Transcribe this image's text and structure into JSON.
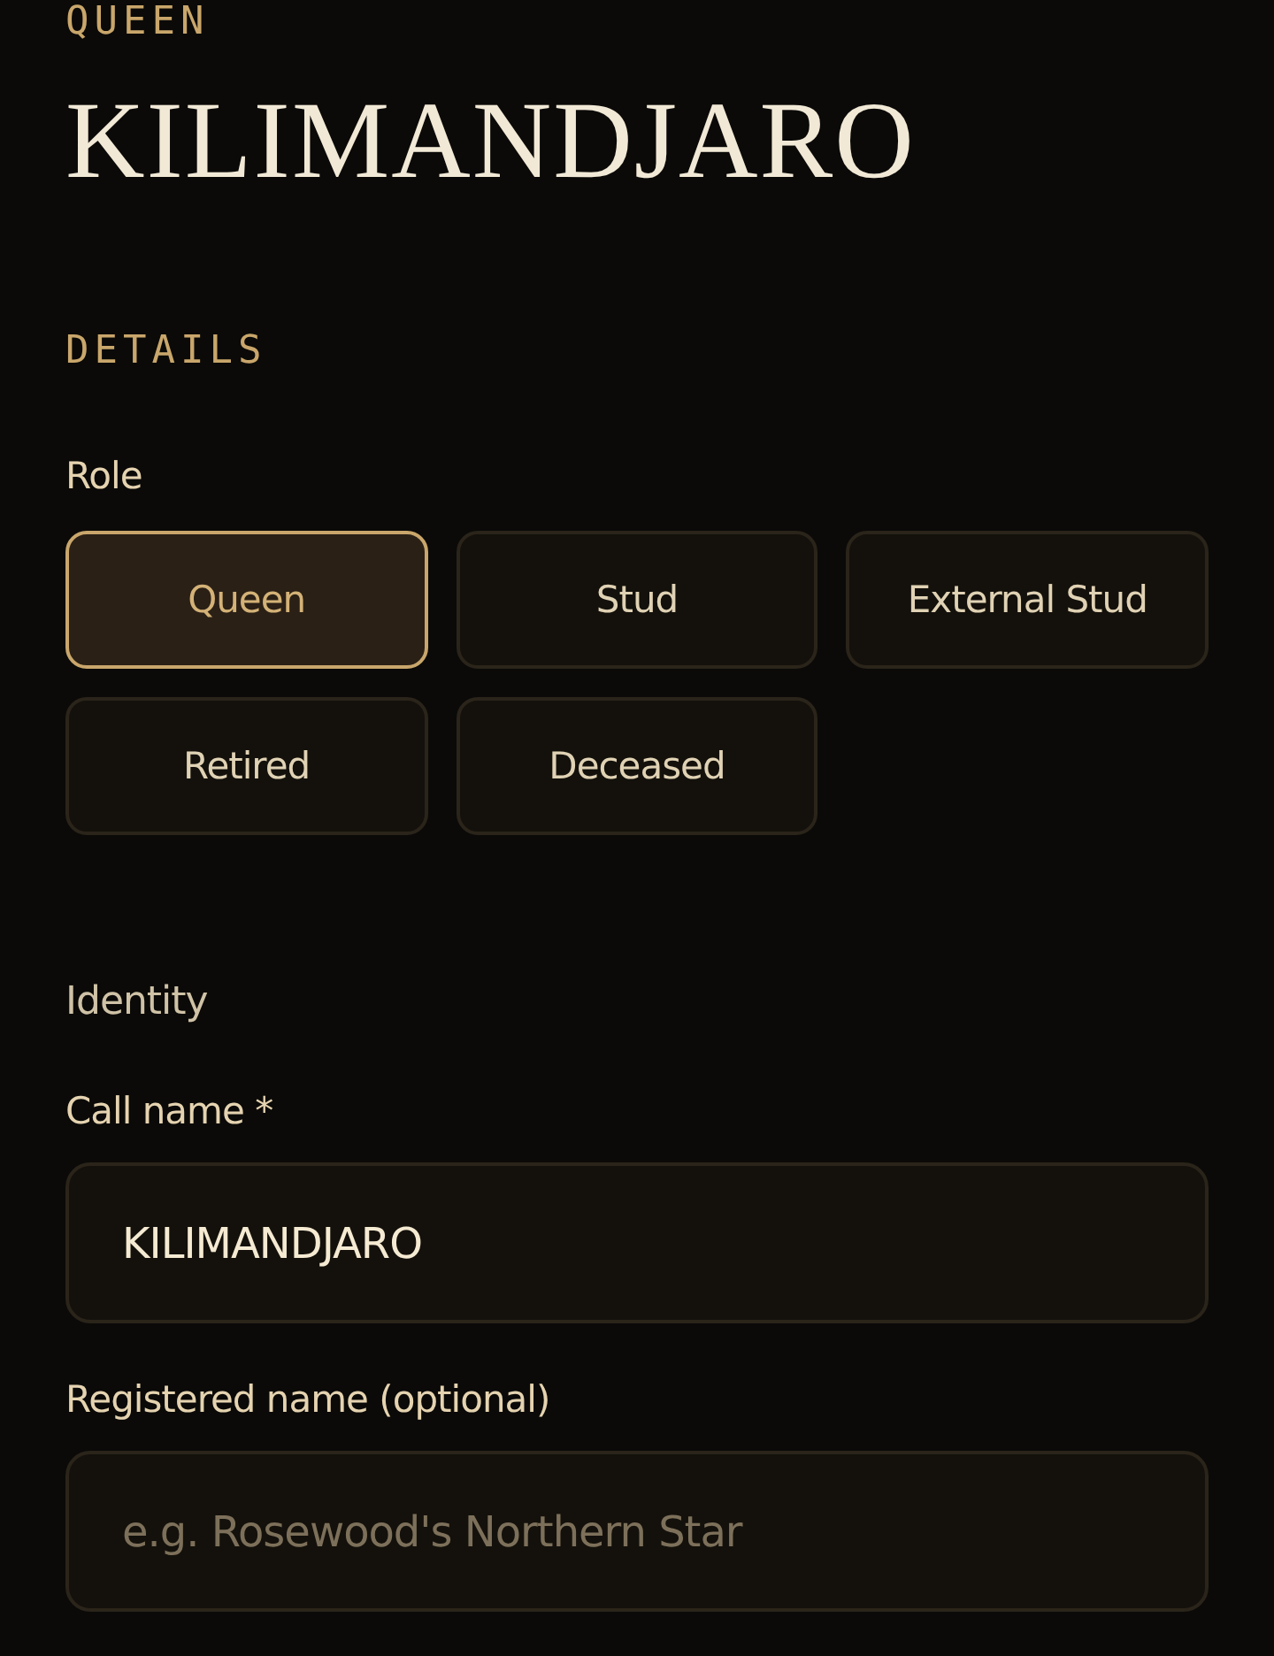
{
  "header": {
    "eyebrow": "QUEEN",
    "title": "KILIMANDJARO"
  },
  "section_title": "DETAILS",
  "role": {
    "label": "Role",
    "options": [
      {
        "label": "Queen",
        "selected": true
      },
      {
        "label": "Stud",
        "selected": false
      },
      {
        "label": "External Stud",
        "selected": false
      },
      {
        "label": "Retired",
        "selected": false
      },
      {
        "label": "Deceased",
        "selected": false
      }
    ]
  },
  "identity": {
    "heading": "Identity",
    "fields": [
      {
        "label": "Call name *",
        "value": "KILIMANDJARO"
      },
      {
        "label": "Registered name (optional)",
        "placeholder": "e.g. Rosewood's Northern Star"
      }
    ]
  }
}
